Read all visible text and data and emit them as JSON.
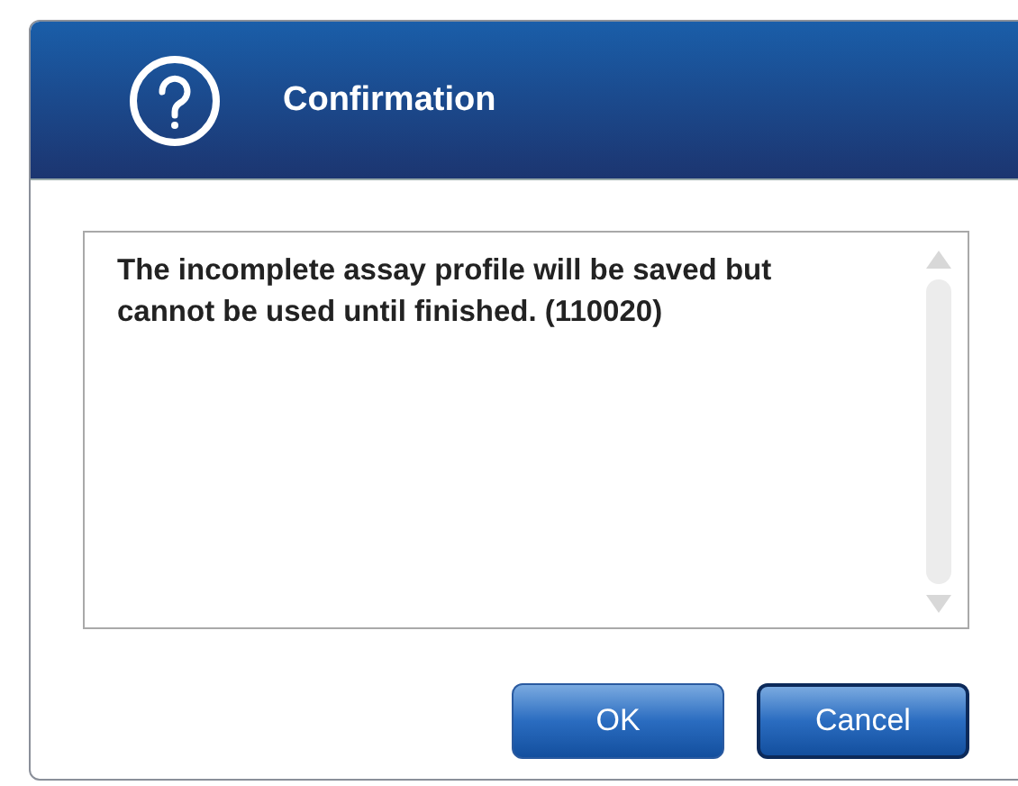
{
  "dialog": {
    "title": "Confirmation",
    "message": "The incomplete assay profile will be saved but cannot be used until finished. (110020)",
    "buttons": [
      {
        "label": "OK",
        "focused": false
      },
      {
        "label": "Cancel",
        "focused": true
      }
    ]
  }
}
